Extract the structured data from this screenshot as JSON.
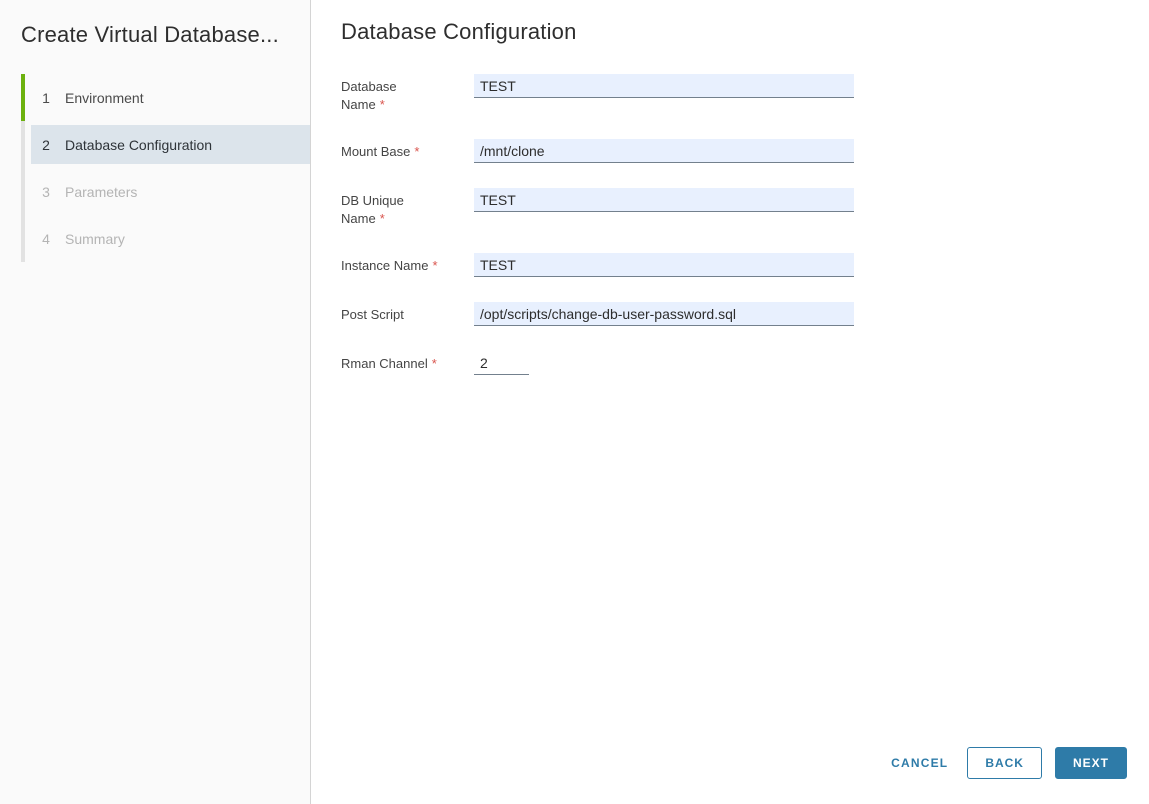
{
  "colors": {
    "accent": "#2e7ba8",
    "step_complete_green": "#6cb10e",
    "current_step_bg": "#dce4eb",
    "input_filled_bg": "#e8f0fe",
    "required_red": "#d9544d",
    "sidebar_bg": "#fafafa"
  },
  "wizard": {
    "title": "Create Virtual Database...",
    "steps": [
      {
        "number": "1",
        "label": "Environment",
        "state": "completed"
      },
      {
        "number": "2",
        "label": "Database Configuration",
        "state": "current"
      },
      {
        "number": "3",
        "label": "Parameters",
        "state": "upcoming"
      },
      {
        "number": "4",
        "label": "Summary",
        "state": "upcoming"
      }
    ]
  },
  "main": {
    "title": "Database Configuration",
    "required_marker": "*",
    "fields": [
      {
        "label": "Database Name",
        "label_lines": [
          "Database",
          "Name"
        ],
        "required": true,
        "value": "TEST"
      },
      {
        "label": "Mount Base",
        "label_lines": [
          "Mount Base"
        ],
        "required": true,
        "value": "/mnt/clone"
      },
      {
        "label": "DB Unique Name",
        "label_lines": [
          "DB Unique",
          "Name"
        ],
        "required": true,
        "value": "TEST"
      },
      {
        "label": "Instance Name",
        "label_lines": [
          "Instance Name"
        ],
        "required": true,
        "value": "TEST"
      },
      {
        "label": "Post Script",
        "label_lines": [
          "Post Script"
        ],
        "required": false,
        "value": "/opt/scripts/change-db-user-password.sql"
      },
      {
        "label": "Rman Channel",
        "label_lines": [
          "Rman Channel"
        ],
        "required": true,
        "value": "2"
      }
    ],
    "footer": {
      "cancel_label": "CANCEL",
      "back_label": "BACK",
      "next_label": "NEXT"
    }
  }
}
